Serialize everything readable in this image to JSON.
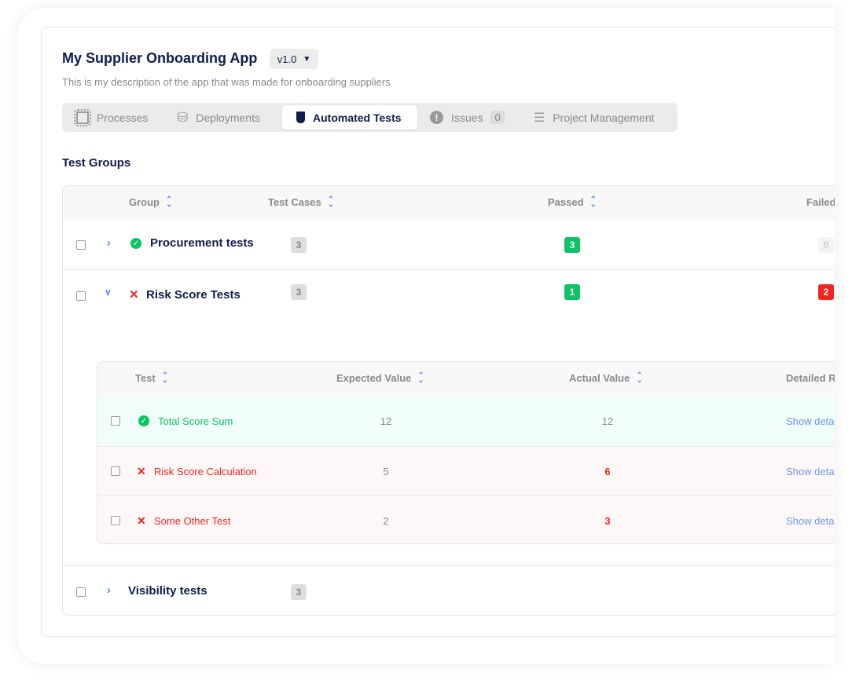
{
  "app": {
    "title": "My Supplier Onboarding App",
    "version": "v1.0",
    "description": "This is my description of the app that was made for onboarding suppliers"
  },
  "tabs": [
    {
      "label": "Processes",
      "icon": "chip-icon"
    },
    {
      "label": "Deployments",
      "icon": "database-check-icon"
    },
    {
      "label": "Automated Tests",
      "icon": "test-tube-icon",
      "active": true
    },
    {
      "label": "Issues",
      "icon": "alert-circle-icon",
      "count": "0"
    },
    {
      "label": "Project Management",
      "icon": "checklist-icon"
    }
  ],
  "section_title": "Test Groups",
  "groups_table": {
    "headers": [
      "Group",
      "Test Cases",
      "Passed",
      "Failed"
    ],
    "rows": [
      {
        "name": "Procurement tests",
        "status": "passed",
        "test_cases": "3",
        "passed": "3",
        "failed": "0",
        "expanded": false
      },
      {
        "name": "Risk Score Tests",
        "status": "failed",
        "test_cases": "3",
        "passed": "1",
        "failed": "2",
        "expanded": true
      },
      {
        "name": "Visibility tests",
        "status": "none",
        "test_cases": "3",
        "expanded": false
      }
    ]
  },
  "tests_table": {
    "headers": [
      "Test",
      "Expected Value",
      "Actual Value",
      "Detailed R"
    ],
    "rows": [
      {
        "name": "Total Score Sum",
        "status": "passed",
        "expected": "12",
        "actual": "12",
        "link": "Show details"
      },
      {
        "name": "Risk Score Calculation",
        "status": "failed",
        "expected": "5",
        "actual": "6",
        "link": "Show details"
      },
      {
        "name": "Some Other Test",
        "status": "failed",
        "expected": "2",
        "actual": "3",
        "link": "Show details"
      }
    ]
  },
  "colors": {
    "navy": "#0f1c4d",
    "green": "#0cc466",
    "red": "#f5231f",
    "link": "#6b97f0"
  }
}
